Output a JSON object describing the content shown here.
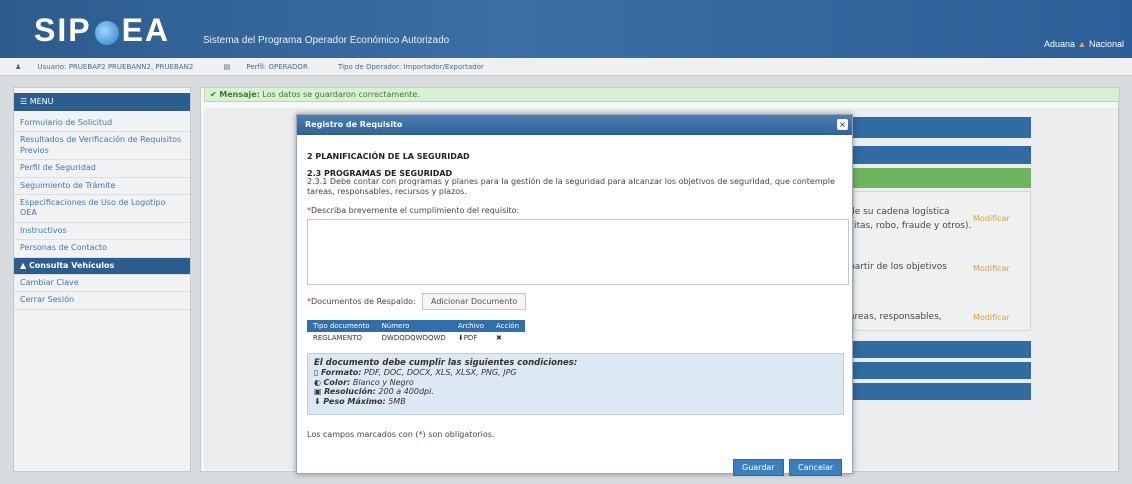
{
  "header": {
    "logo_left": "SIP",
    "logo_right": "EA",
    "system_title": "Sistema del Programa Operador Económico Autorizado",
    "top_right_left": "Aduana",
    "top_right_right": "Nacional"
  },
  "userbar": {
    "user": "Usuario: PRUEBAP2 PRUEBANN2, PRUEBAN2",
    "profile": "Perfil: OPERADOR",
    "operator_type": "Tipo de Operador: Importador/Exportador"
  },
  "sidebar": {
    "menu_label": "MENU",
    "items": [
      {
        "label": "Formulario de Solicitud"
      },
      {
        "label": "Resultados de Verificación de Requisitos Previos"
      },
      {
        "label": "Perfil de Seguridad"
      },
      {
        "label": "Seguimiento de Trámite"
      },
      {
        "label": "Especificaciones de Uso de Logotipo OEA"
      },
      {
        "label": "Instructivos"
      },
      {
        "label": "Personas de Contacto"
      },
      {
        "label": "Consulta Vehículos"
      },
      {
        "label": "Cambiar Clave"
      },
      {
        "label": "Cerrar Sesión"
      }
    ]
  },
  "message": {
    "prefix": "Mensaje:",
    "text": "Los datos se guardaron correctamente."
  },
  "background": {
    "row1_line1": "de su cadena logística",
    "row1_line2": "citas, robo, fraude y otros).",
    "row2": "partir de los objetivos",
    "row3": "areas, responsables,",
    "modify": "Modificar"
  },
  "modal": {
    "title": "Registro de Requisito",
    "close": "×",
    "section": "2 PLANIFICACIÓN DE LA SEGURIDAD",
    "subsection": "2.3 PROGRAMAS DE SEGURIDAD",
    "description": "2.3.1 Debe contar con programas y planes para la gestión de la seguridad para alcanzar los objetivos de seguridad, que contemple tareas, responsables, recursos y plazos.",
    "requirement_label": "Describa brevemente el cumplimiento del requisito:",
    "required_mark": "*",
    "documents_label": "Documentos de Respaldo:",
    "add_document": "Adicionar Documento",
    "table_headers": [
      "Tipo documento",
      "Número",
      "Archivo",
      "Acción"
    ],
    "table_rows": [
      {
        "tipo": "REGLAMENTO",
        "numero": "DWDQDQWDQWD",
        "archivo": "PDF",
        "accion": "✖"
      }
    ],
    "conditions_title": "El documento debe cumplir las siguientes condiciones:",
    "conditions": [
      {
        "label": "Formato:",
        "value": "PDF, DOC, DOCX, XLS, XLSX, PNG, JPG"
      },
      {
        "label": "Color:",
        "value": "Blanco y Negro"
      },
      {
        "label": "Resolución:",
        "value": "200 a 400dpi."
      },
      {
        "label": "Peso Máximo:",
        "value": "5MB"
      }
    ],
    "required_note_pre": "Los campos marcados con (",
    "required_note_post": ") son obligatorios.",
    "save": "Guardar",
    "cancel": "Cancelar"
  }
}
